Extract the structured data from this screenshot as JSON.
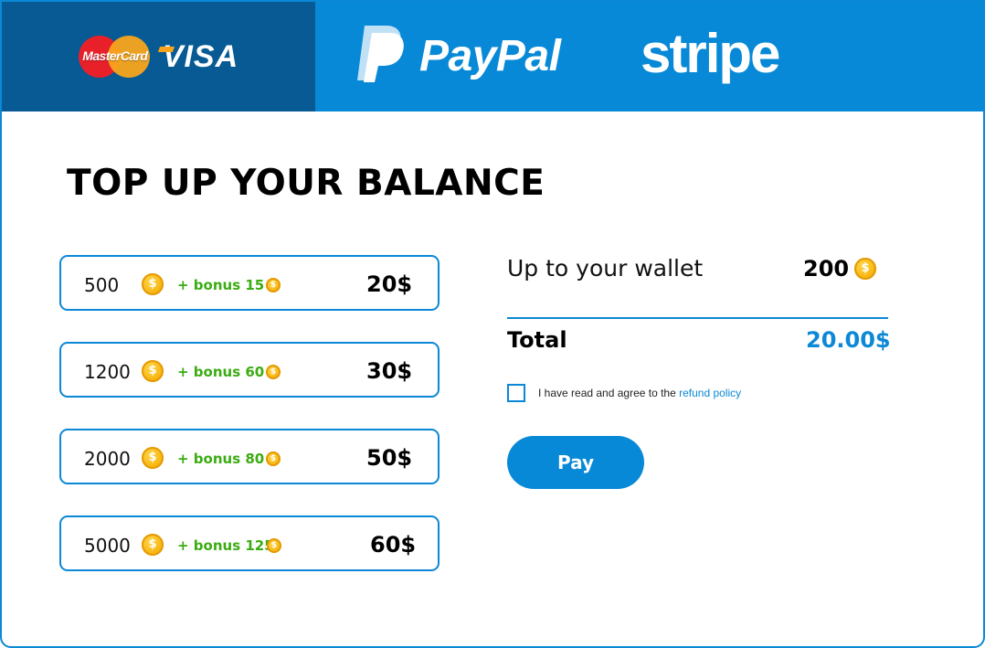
{
  "colors": {
    "accent": "#0789d7",
    "accent_dark": "#075a94",
    "bonus_green": "#3bac12",
    "coin_gold": "#f8b713"
  },
  "payment_methods": {
    "mastercard": "MasterCard",
    "visa": "VISA",
    "paypal": "PayPal",
    "stripe": "stripe"
  },
  "page_title": "TOP UP YOUR BALANCE",
  "coin_symbol": "$",
  "options": [
    {
      "amount": "500",
      "bonus": "+ bonus 15",
      "price": "20$"
    },
    {
      "amount": "1200",
      "bonus": "+ bonus 60",
      "price": "30$"
    },
    {
      "amount": "2000",
      "bonus": "+ bonus 80",
      "price": "50$"
    },
    {
      "amount": "5000",
      "bonus": "+ bonus 125",
      "price": "60$"
    }
  ],
  "summary": {
    "wallet_label": "Up to your wallet",
    "wallet_value": "200",
    "total_label": "Total",
    "total_value": "20.00$",
    "agree_text": "I have read and agree to the",
    "agree_link": "refund policy",
    "agree_checked": false,
    "pay_label": "Pay"
  }
}
